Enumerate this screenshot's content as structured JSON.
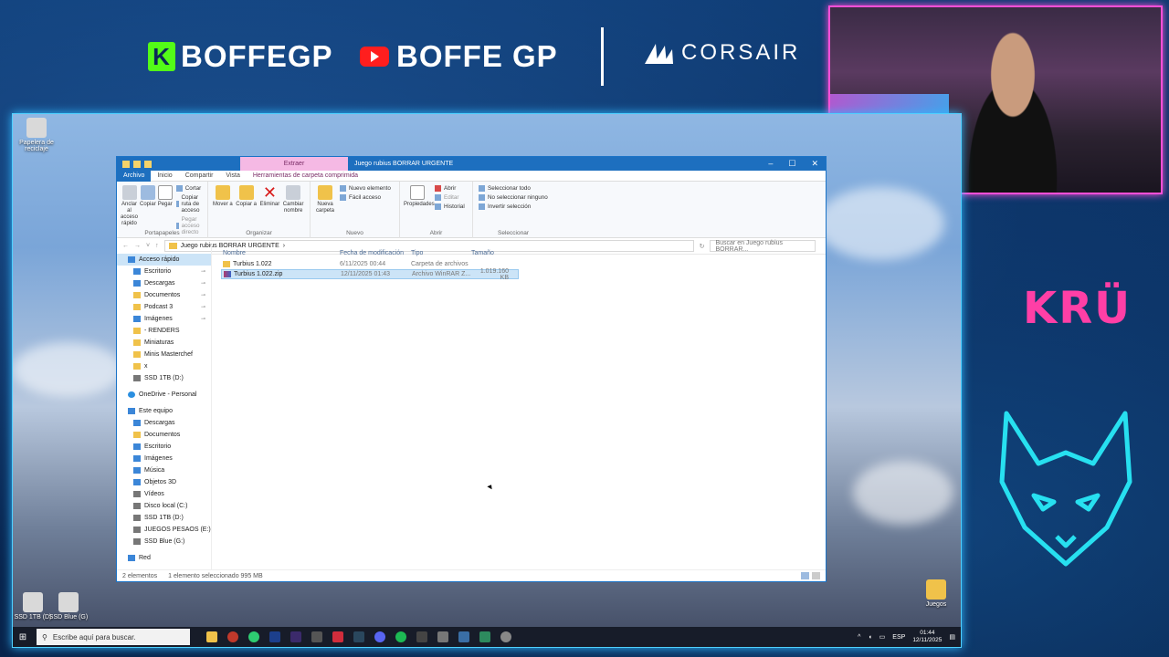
{
  "overlay": {
    "kick_name": "BOFFEGP",
    "youtube_name": "BOFFE GP",
    "sponsor": "CORSAIR",
    "right_logo": "KRÜ"
  },
  "desktop": {
    "icons": [
      {
        "label": "Papelera de reciclaje",
        "icon": "recycle-bin-icon"
      },
      {
        "label": "SSD 1TB (D)",
        "icon": "drive-icon"
      },
      {
        "label": "SSD Blue (G)",
        "icon": "drive-icon"
      },
      {
        "label": "Juegos",
        "icon": "folder-icon"
      }
    ]
  },
  "explorer": {
    "context_tab": "Extraer",
    "window_title": "Juego rubius BORRAR URGENTE",
    "tabs": [
      "Archivo",
      "Inicio",
      "Compartir",
      "Vista",
      "Herramientas de carpeta comprimida"
    ],
    "ribbon": {
      "portapapeles": {
        "name": "Portapapeles",
        "pin": "Anclar al acceso rápido",
        "copy": "Copiar",
        "paste": "Pegar",
        "cut": "Cortar",
        "copy_path": "Copiar ruta de acceso",
        "paste_shortcut": "Pegar acceso directo"
      },
      "organizar": {
        "name": "Organizar",
        "move": "Mover a",
        "copy_to": "Copiar a",
        "delete": "Eliminar",
        "rename": "Cambiar nombre"
      },
      "nuevo": {
        "name": "Nuevo",
        "new_folder": "Nueva carpeta",
        "new_item": "Nuevo elemento",
        "easy_access": "Fácil acceso"
      },
      "abrir": {
        "name": "Abrir",
        "properties": "Propiedades",
        "open": "Abrir",
        "edit": "Editar",
        "history": "Historial"
      },
      "seleccionar": {
        "name": "Seleccionar",
        "select_all": "Seleccionar todo",
        "select_none": "No seleccionar ninguno",
        "invert": "Invertir selección"
      }
    },
    "address": {
      "path": "Juego rubius BORRAR URGENTE",
      "search_placeholder": "Buscar en Juego rubius BORRAR..."
    },
    "nav": [
      {
        "label": "Acceso rápido",
        "icon": "star-icon",
        "top": true,
        "selected": true
      },
      {
        "label": "Escritorio",
        "icon": "desktop-icon",
        "pinned": true
      },
      {
        "label": "Descargas",
        "icon": "download-icon",
        "pinned": true
      },
      {
        "label": "Documentos",
        "icon": "documents-icon",
        "pinned": true
      },
      {
        "label": "Podcast 3",
        "icon": "folder-icon",
        "pinned": true
      },
      {
        "label": "Imágenes",
        "icon": "pictures-icon",
        "pinned": true
      },
      {
        "label": "- RENDERS",
        "icon": "folder-icon"
      },
      {
        "label": "Miniaturas",
        "icon": "folder-icon"
      },
      {
        "label": "Minis Masterchef",
        "icon": "folder-icon"
      },
      {
        "label": "x",
        "icon": "folder-icon"
      },
      {
        "label": "SSD 1TB (D:)",
        "icon": "drive-icon"
      },
      {
        "label": "OneDrive - Personal",
        "icon": "cloud-icon",
        "top": true
      },
      {
        "label": "Este equipo",
        "icon": "computer-icon",
        "top": true
      },
      {
        "label": "Descargas",
        "icon": "download-icon"
      },
      {
        "label": "Documentos",
        "icon": "documents-icon"
      },
      {
        "label": "Escritorio",
        "icon": "desktop-icon"
      },
      {
        "label": "Imágenes",
        "icon": "pictures-icon"
      },
      {
        "label": "Música",
        "icon": "music-icon"
      },
      {
        "label": "Objetos 3D",
        "icon": "cube-icon"
      },
      {
        "label": "Vídeos",
        "icon": "video-icon"
      },
      {
        "label": "Disco local (C:)",
        "icon": "drive-icon"
      },
      {
        "label": "SSD 1TB (D:)",
        "icon": "drive-icon"
      },
      {
        "label": "JUEGOS PESAOS (E:)",
        "icon": "drive-icon"
      },
      {
        "label": "SSD Blue (G:)",
        "icon": "drive-icon"
      },
      {
        "label": "Red",
        "icon": "network-icon",
        "top": true
      }
    ],
    "columns": [
      "Nombre",
      "Fecha de modificación",
      "Tipo",
      "Tamaño"
    ],
    "files": [
      {
        "name": "Turbius 1.022",
        "date": "6/11/2025 00:44",
        "type": "Carpeta de archivos",
        "size": "",
        "icon": "folder-icon",
        "selected": false
      },
      {
        "name": "Turbius 1.022.zip",
        "date": "12/11/2025 01:43",
        "type": "Archivo WinRAR Z...",
        "size": "1.019.160 KB",
        "icon": "zip-icon",
        "selected": true
      }
    ],
    "status": {
      "count": "2 elementos",
      "selection": "1 elemento seleccionado 995 MB"
    }
  },
  "taskbar": {
    "search_placeholder": "Escribe aquí para buscar.",
    "lang": "ESP",
    "time": "01:44",
    "date": "12/11/2025"
  }
}
